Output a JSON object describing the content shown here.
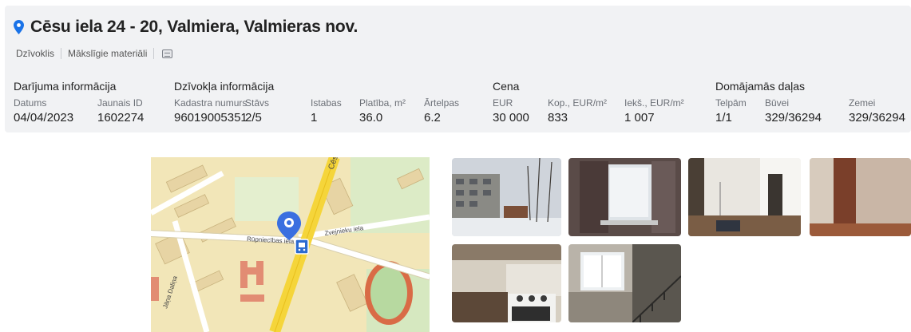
{
  "header": {
    "title": "Cēsu iela 24 - 20, Valmiera, Valmieras nov.",
    "tags": [
      "Dzīvoklis",
      "Mākslīgie materiāli"
    ],
    "doc_icon": "document-icon",
    "pin_icon": "location-pin-icon",
    "accent": "#1a73e8"
  },
  "sections": {
    "deal": "Darījuma informācija",
    "apartment": "Dzīvokļa informācija",
    "price": "Cena",
    "shares": "Domājamās daļas"
  },
  "fields": {
    "date": {
      "label": "Datums",
      "value": "04/04/2023"
    },
    "new_id": {
      "label": "Jaunais ID",
      "value": "1602274"
    },
    "cadastre": {
      "label": "Kadastra numurs",
      "value": "96019005351"
    },
    "floor": {
      "label": "Stāvs",
      "value": "2/5"
    },
    "rooms": {
      "label": "Istabas",
      "value": "1"
    },
    "area": {
      "label": "Platība, m²",
      "value": "36.0"
    },
    "outdoor": {
      "label": "Ārtelpas",
      "value": "6.2"
    },
    "eur": {
      "label": "EUR",
      "value": "30 000"
    },
    "total_per_m2": {
      "label": "Kop., EUR/m²",
      "value": "833"
    },
    "inner_per_m2": {
      "label": "Iekš., EUR/m²",
      "value": "1 007"
    },
    "premises": {
      "label": "Telpām",
      "value": "1/1"
    },
    "building": {
      "label": "Būvei",
      "value": "329/36294"
    },
    "land": {
      "label": "Zemei",
      "value": "329/36294"
    }
  },
  "map": {
    "street_labels": [
      "Cēsu",
      "Rūpniecības iela",
      "Zvejnieku iela",
      "Jāņa Daliņa"
    ],
    "marker_icon": "location-marker-icon",
    "bus_stop_icon": "bus-stop-icon"
  }
}
